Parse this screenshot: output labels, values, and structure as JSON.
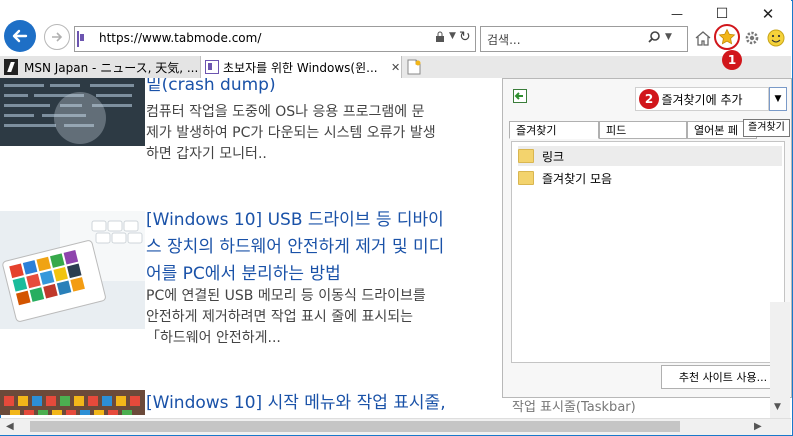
{
  "window": {
    "minimize": "—",
    "maximize": "☐",
    "close": "✕"
  },
  "toolbar": {
    "url": "https://www.tabmode.com/",
    "search_placeholder": "검색...",
    "refresh_glyph": "↻",
    "lock_glyph": "🔒"
  },
  "tabs": [
    {
      "label": "MSN Japan - ニュース, 天気, ...",
      "icon": "msn-icon"
    },
    {
      "label": "초보자를 위한 Windows(윈...",
      "icon": "tabmode-icon",
      "active": true
    }
  ],
  "articles": [
    {
      "title": "밑(crash dump)",
      "body": "컴퓨터 작업을 도중에 OS나 응용 프로그램에 문제가 발생하여 PC가 다운되는 시스템 오류가 발생하면 갑자기 모니터..",
      "lines": [
        "컴퓨터 작업을 도중에 OS나 응용 프로그램에 문",
        "제가 발생하여 PC가 다운되는 시스템 오류가 발생",
        "하면 갑자기 모니터.."
      ]
    },
    {
      "title_lines": [
        "[Windows 10] USB 드라이브 등 디바이",
        "스 장치의 하드웨어 안전하게 제거 및 미디",
        "어를 PC에서 분리하는 방법"
      ],
      "lines": [
        "PC에 연결된 USB 메모리 등 이동식 드라이브를",
        "안전하게 제거하려면 작업 표시 줄에 표시되는",
        "「하드웨어 안전하게..."
      ]
    },
    {
      "title_lines": [
        "[Windows 10] 시작 메뉴와 작업 표시줄,"
      ]
    }
  ],
  "sidebar_behind": "작업 표시줄(Taskbar)",
  "favorites_panel": {
    "add_button": "즐겨찾기에 추가",
    "tooltip": "즐겨찾기",
    "tabs": [
      "즐겨찾기",
      "피드",
      "열어본 페"
    ],
    "items": [
      "링크",
      "즐겨찾기 모음"
    ],
    "suggested_button": "추천 사이트 사용..."
  },
  "callouts": [
    "1",
    "2"
  ],
  "colors": {
    "accent": "#1e6fc6",
    "link": "#1a52a8",
    "badge": "#d1161b",
    "window_border": "#1979ca"
  }
}
